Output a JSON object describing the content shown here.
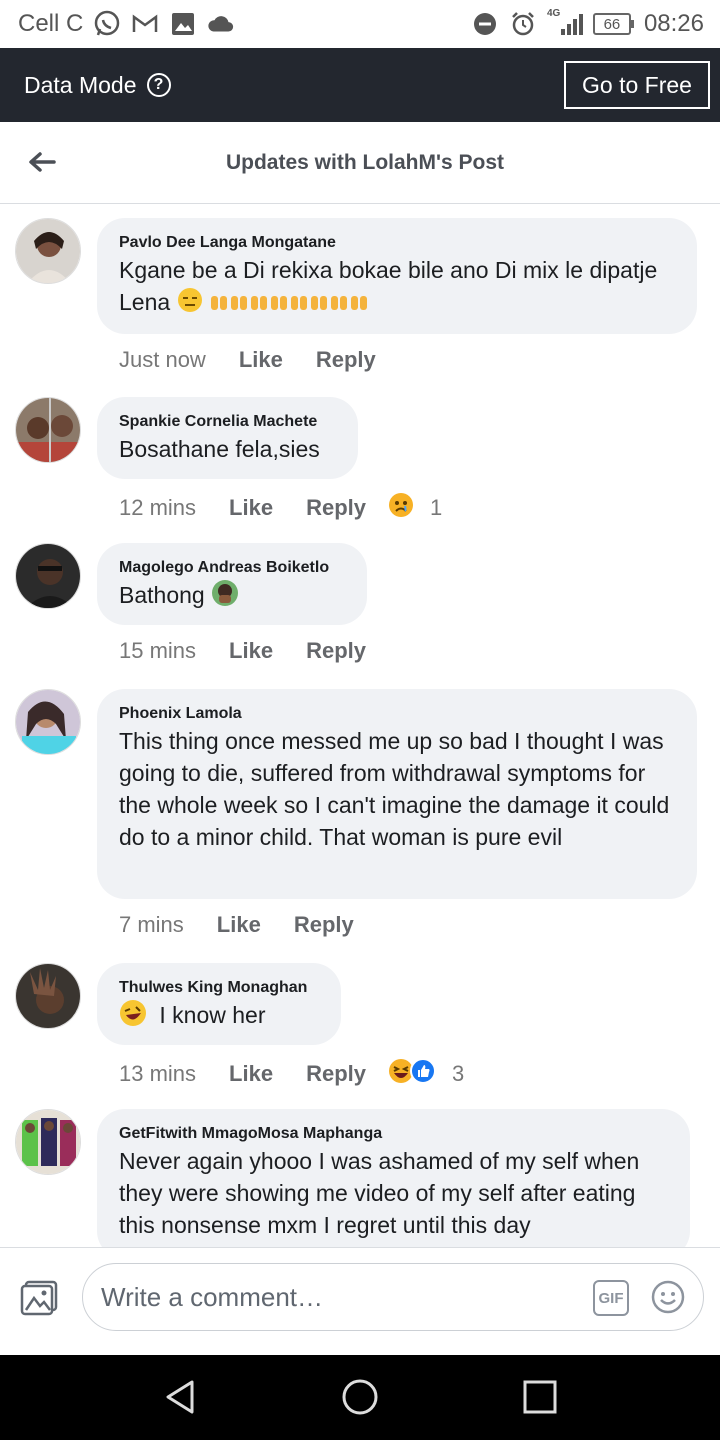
{
  "status_bar": {
    "carrier": "Cell C",
    "network": "4G",
    "battery": "66",
    "time": "08:26"
  },
  "data_bar": {
    "title": "Data Mode",
    "go_free_label": "Go to Free"
  },
  "header": {
    "title": "Updates with LolahM's Post"
  },
  "comments": [
    {
      "author": "Pavlo Dee Langa Mongatane",
      "text": "Kgane be a Di rekixa bokae bile ano Di mix le dipatje Lena",
      "time": "Just now",
      "like": "Like",
      "reply": "Reply",
      "reaction_count": ""
    },
    {
      "author": "Spankie Cornelia Machete",
      "text": "Bosathane fela,sies",
      "time": "12 mins",
      "like": "Like",
      "reply": "Reply",
      "reaction_count": "1"
    },
    {
      "author": "Magolego Andreas Boiketlo",
      "text": "Bathong",
      "time": "15 mins",
      "like": "Like",
      "reply": "Reply",
      "reaction_count": ""
    },
    {
      "author": "Phoenix Lamola",
      "text": "This thing once messed me up so bad I thought I was going to die, suffered from withdrawal symptoms for the whole week so I can't imagine the damage it could do to a minor child. That woman is pure evil",
      "time": "7 mins",
      "like": "Like",
      "reply": "Reply",
      "reaction_count": ""
    },
    {
      "author": "Thulwes King Monaghan",
      "text": "I know her",
      "time": "13 mins",
      "like": "Like",
      "reply": "Reply",
      "reaction_count": "3"
    },
    {
      "author": "GetFitwith MmagoMosa Maphanga",
      "text": "Never again yhooo  I was ashamed of my self when they were showing me video of my self after eating this nonsense mxm I regret until this day",
      "time": "",
      "like": "",
      "reply": "",
      "reaction_count": ""
    }
  ],
  "composer": {
    "placeholder": "Write a comment…",
    "gif_label": "GIF"
  },
  "colors": {
    "data_bar_bg": "#23272f",
    "bubble_bg": "#f0f2f5",
    "like_blue": "#1877f2",
    "reaction_yellow": "#f7b125"
  }
}
